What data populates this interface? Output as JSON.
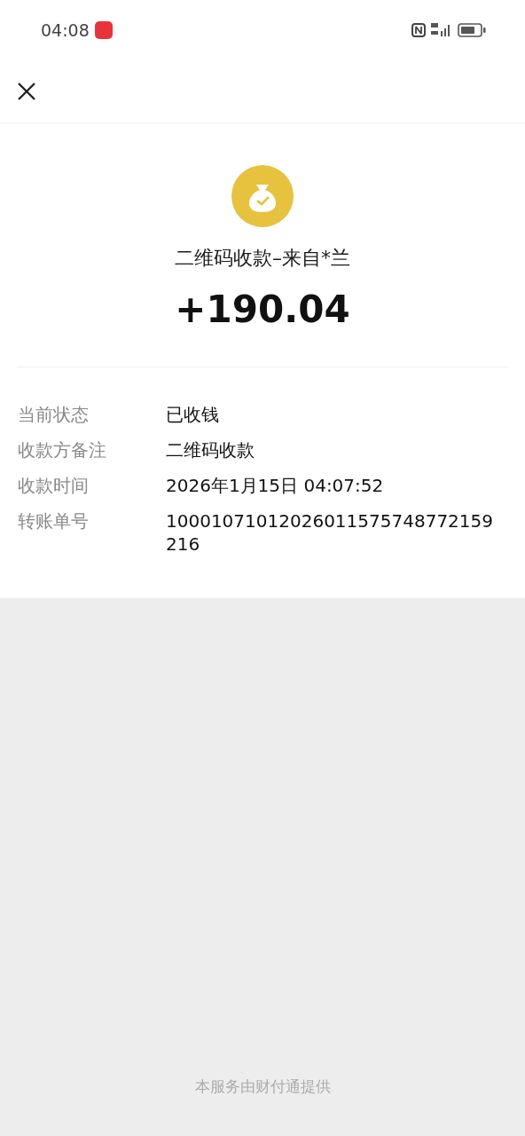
{
  "status_bar": {
    "time": "04:08"
  },
  "summary": {
    "title": "二维码收款–来自*兰",
    "amount": "+190.04"
  },
  "details": [
    {
      "label": "当前状态",
      "value": "已收钱"
    },
    {
      "label": "收款方备注",
      "value": "二维码收款"
    },
    {
      "label": "收款时间",
      "value": "2026年1月15日 04:07:52"
    },
    {
      "label": "转账单号",
      "value": "10001071012026011575748772159216"
    }
  ],
  "footer": "本服务由财付通提供"
}
